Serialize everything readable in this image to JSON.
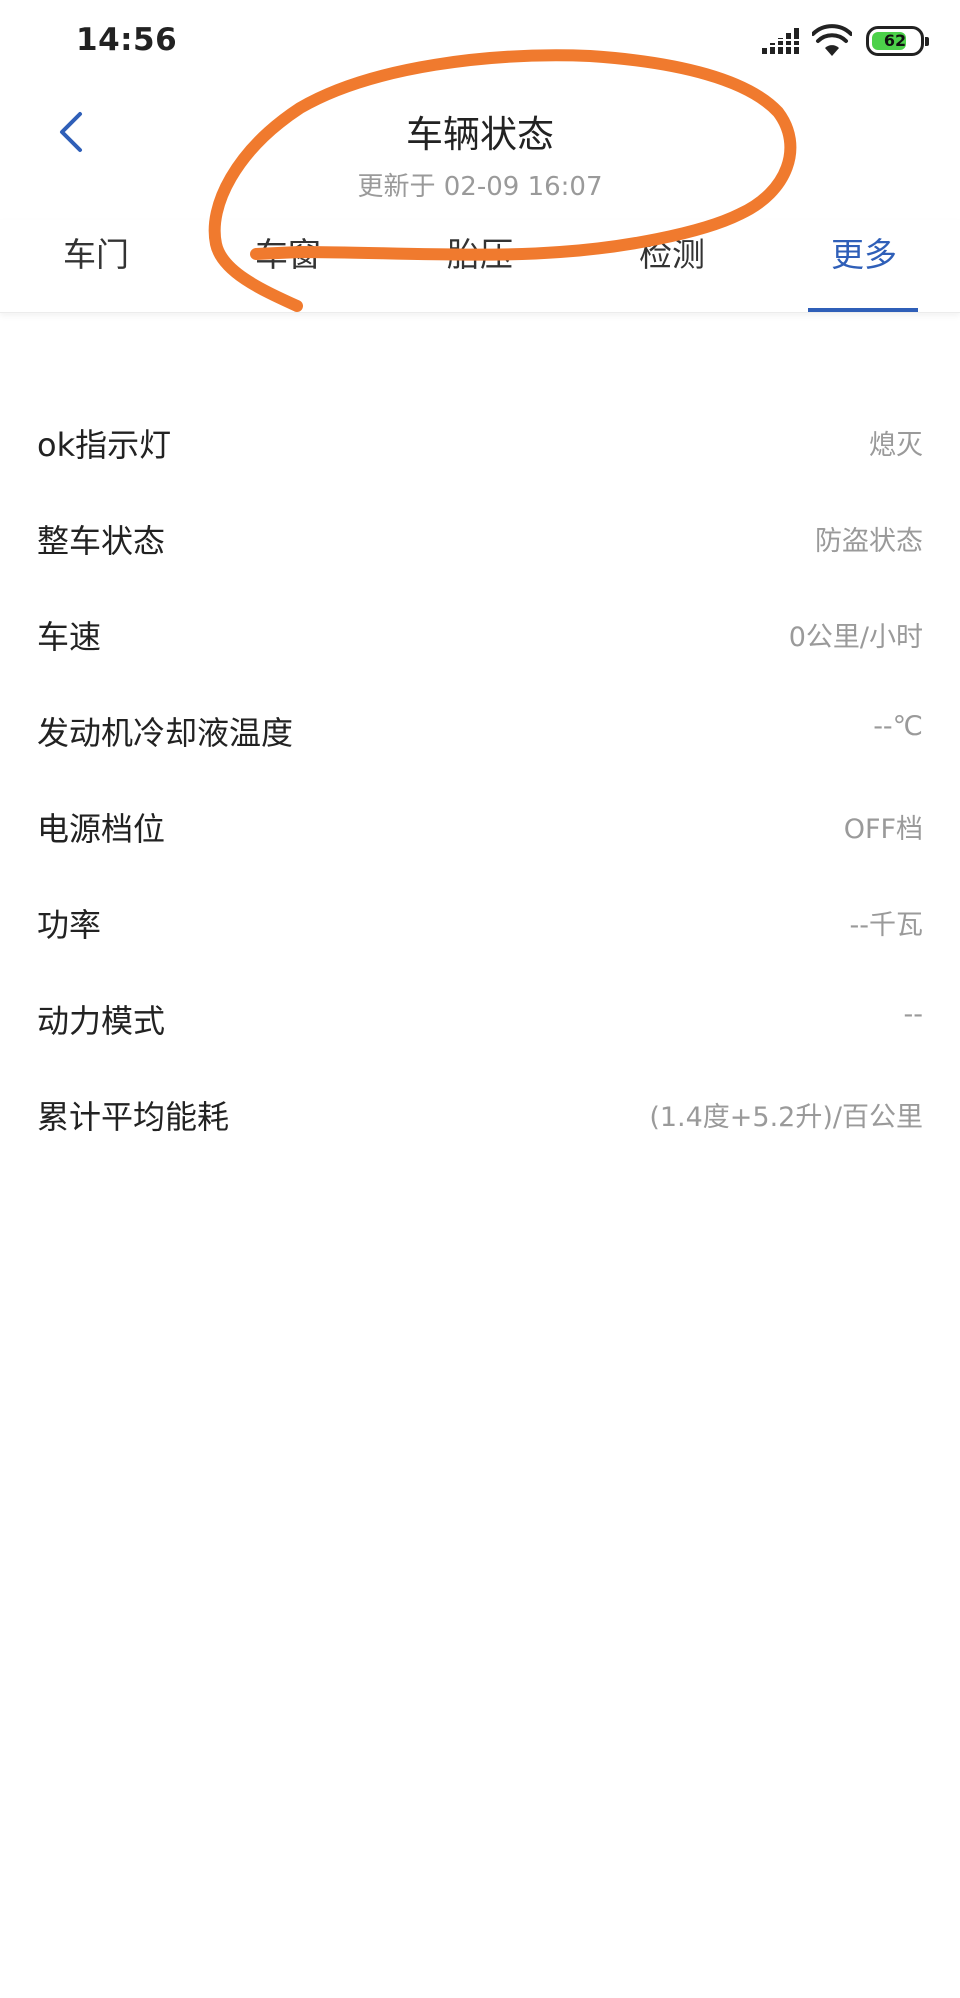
{
  "status_bar": {
    "time": "14:56",
    "battery_level": "62",
    "icons": [
      "signal-icon",
      "wifi-icon",
      "battery-icon"
    ]
  },
  "header": {
    "title": "车辆状态",
    "subtitle": "更新于 02-09 16:07",
    "back_icon": "chevron-left-icon"
  },
  "tabs": [
    {
      "label": "车门",
      "active": false
    },
    {
      "label": "车窗",
      "active": false
    },
    {
      "label": "胎压",
      "active": false
    },
    {
      "label": "检测",
      "active": false
    },
    {
      "label": "更多",
      "active": true
    }
  ],
  "items": [
    {
      "label": "ok指示灯",
      "value": "熄灭"
    },
    {
      "label": "整车状态",
      "value": "防盗状态"
    },
    {
      "label": "车速",
      "value": "0公里/小时"
    },
    {
      "label": "发动机冷却液温度",
      "value": "--℃"
    },
    {
      "label": "电源档位",
      "value": "OFF档"
    },
    {
      "label": "功率",
      "value": "--千瓦"
    },
    {
      "label": "动力模式",
      "value": "--"
    },
    {
      "label": "累计平均能耗",
      "value": "(1.4度+5.2升)/百公里"
    }
  ],
  "colors": {
    "accent": "#2f5fb8",
    "secondary_text": "#9a9a9a",
    "primary_text": "#222222",
    "battery_green": "#4cd14a",
    "annotation": "#f07a2e"
  }
}
